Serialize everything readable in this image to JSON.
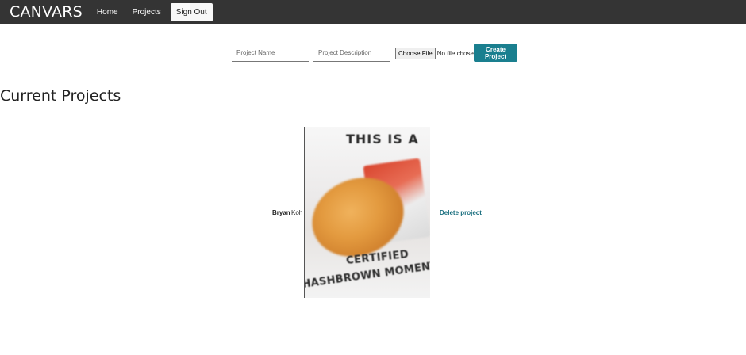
{
  "navbar": {
    "brand": "CANVARS",
    "links": [
      "Home",
      "Projects"
    ],
    "signout_label": "Sign Out"
  },
  "create_form": {
    "name_placeholder": "Project Name",
    "description_placeholder": "Project Description",
    "file_button_label": "Choose File",
    "file_status": "No file chosen",
    "submit_label": "Create Project"
  },
  "section_title": "Current Projects",
  "projects": [
    {
      "first_name": "Bryan",
      "last_name": "Koh",
      "image_text_top": "THIS IS A",
      "image_text_bottom_1": "CERTIFIED",
      "image_text_bottom_2": "HASHBROWN MOMENT",
      "delete_label": "Delete project"
    }
  ],
  "colors": {
    "navbar_bg": "#343434",
    "accent": "#1a7f8f",
    "link": "#1a6f7f"
  }
}
